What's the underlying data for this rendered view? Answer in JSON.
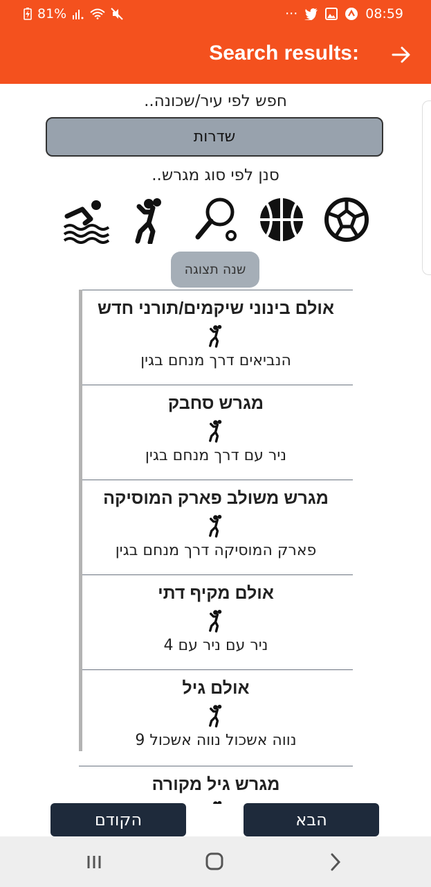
{
  "status": {
    "battery": "81%",
    "dots": "···",
    "time": "08:59"
  },
  "header": {
    "title": "Search results:",
    "back_icon": "arrow-right-icon"
  },
  "search": {
    "city_label": "חפש לפי עיר/שכונה..",
    "city_value": "שדרות",
    "type_label": "סנן לפי סוג מגרש.."
  },
  "sports": [
    {
      "name": "soccer",
      "icon": "soccer-ball-icon"
    },
    {
      "name": "basketball",
      "icon": "basketball-icon"
    },
    {
      "name": "tennis",
      "icon": "tennis-racket-icon"
    },
    {
      "name": "handball",
      "icon": "handball-icon"
    },
    {
      "name": "swimming",
      "icon": "swimming-icon"
    }
  ],
  "toggle_view_label": "שנה תצוגה",
  "results": [
    {
      "name": "אולם בינוני שיקמים/תורני חדש",
      "address": "הנביאים דרך מנחם בגין",
      "icon": "handball-icon"
    },
    {
      "name": "מגרש סחבק",
      "address": "ניר עם דרך מנחם בגין",
      "icon": "handball-icon"
    },
    {
      "name": "מגרש משולב פארק המוסיקה",
      "address": "פארק המוסיקה דרך מנחם בגין",
      "icon": "handball-icon"
    },
    {
      "name": "אולם מקיף דתי",
      "address": "ניר עם ניר עם 4",
      "icon": "handball-icon"
    },
    {
      "name": "אולם גיל",
      "address": "נווה אשכול נווה אשכול 9",
      "icon": "handball-icon"
    },
    {
      "name": "מגרש גיל מקורה",
      "address": "",
      "icon": "handball-icon"
    }
  ],
  "buttons": {
    "previous": "הקודם",
    "next": "הבא"
  },
  "colors": {
    "accent": "#f4511e",
    "nav_button": "#1e2a3b",
    "input_bg": "#98a2ad"
  }
}
